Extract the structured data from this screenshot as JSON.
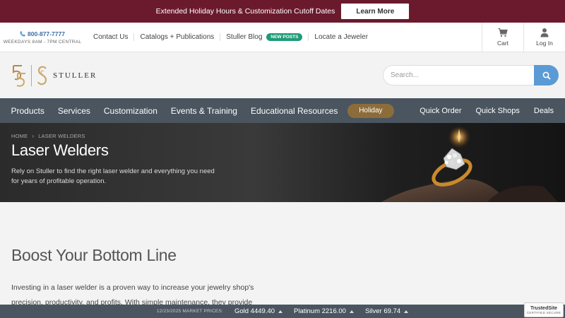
{
  "promo": {
    "text": "Extended Holiday Hours & Customization Cutoff Dates",
    "button": "Learn More"
  },
  "utility": {
    "phone": "800-877-7777",
    "hours": "WEEKDAYS 8AM - 7PM CENTRAL",
    "links": [
      "Contact Us",
      "Catalogs + Publications",
      "Stuller Blog",
      "Locate a Jeweler"
    ],
    "blog_badge": "NEW POSTS",
    "cart_label": "Cart",
    "login_label": "Log In"
  },
  "brand": {
    "logo_text": "STULLER",
    "search_placeholder": "Search..."
  },
  "nav": {
    "items": [
      "Products",
      "Services",
      "Customization",
      "Events & Training",
      "Educational Resources"
    ],
    "holiday": "Holiday",
    "right": [
      "Quick Order",
      "Quick Shops",
      "Deals"
    ]
  },
  "hero": {
    "breadcrumb": [
      "HOME",
      "LASER WELDERS"
    ],
    "title": "Laser Welders",
    "description": "Rely on Stuller to find the right laser welder and everything you need for years of profitable operation."
  },
  "content": {
    "title": "Boost Your Bottom Line",
    "text": "Investing in a laser welder is a proven way to increase your jewelry shop's precision, productivity, and profits. With simple maintenance, they provide years of return on"
  },
  "ticker": {
    "date": "12/23/2025 MARKET PRICES:",
    "metals": [
      {
        "label": "Gold 4449.40"
      },
      {
        "label": "Platinum 2216.00"
      },
      {
        "label": "Silver 69.74"
      }
    ]
  },
  "trusted": {
    "name": "TrustedSite",
    "sub": "CERTIFIED SECURE"
  },
  "colors": {
    "promo": "#6b1a2e",
    "nav": "#4a5560",
    "accent_blue": "#5b9bd5",
    "badge_green": "#1f9b78",
    "holiday_gold": "#8c6d3a",
    "logo_gold": "#c9a96b"
  }
}
